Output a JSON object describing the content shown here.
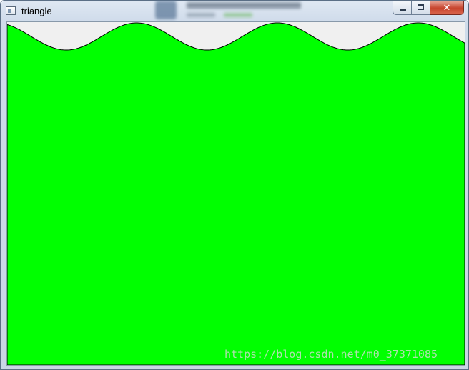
{
  "window": {
    "title": "triangle",
    "controls": {
      "minimize_icon": "minimize-icon",
      "maximize_icon": "maximize-icon",
      "close_glyph": "✕"
    }
  },
  "canvas": {
    "fill_color": "#00ff00",
    "background_color": "#f0f0f0",
    "wave_periods": 3.25
  },
  "watermark": "https://blog.csdn.net/m0_37371085"
}
